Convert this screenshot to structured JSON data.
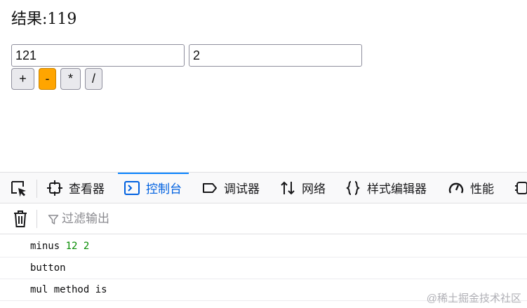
{
  "page": {
    "result_label": "结果:",
    "result_value": "119",
    "input_a": "121",
    "input_b": "2",
    "buttons": [
      "+",
      "-",
      "*",
      "/"
    ],
    "active_button": "-",
    "active_color": "#ffa500"
  },
  "devtools": {
    "tabs": [
      {
        "label": "查看器",
        "icon": "inspector-icon"
      },
      {
        "label": "控制台",
        "icon": "console-icon",
        "selected": true
      },
      {
        "label": "调试器",
        "icon": "debugger-icon"
      },
      {
        "label": "网络",
        "icon": "network-icon"
      },
      {
        "label": "样式编辑器",
        "icon": "style-editor-icon"
      },
      {
        "label": "性能",
        "icon": "performance-icon"
      }
    ],
    "accent_color": "#0a84ff",
    "filter_placeholder": "过滤输出",
    "console_rows": [
      {
        "text": "minus",
        "args": "12 2"
      },
      {
        "text": "button"
      },
      {
        "text": "mul method is"
      }
    ]
  },
  "watermark": "@稀土掘金技术社区"
}
